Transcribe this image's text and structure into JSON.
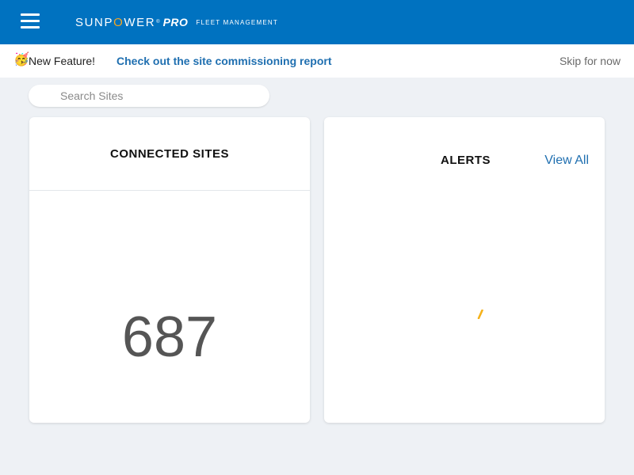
{
  "header": {
    "menu_icon": "hamburger-menu-icon",
    "brand": {
      "name_part1": "SUNP",
      "name_o": "O",
      "name_part2": "WER",
      "registered": "®",
      "pro": "PRO",
      "subtitle": "FLEET MANAGEMENT",
      "accent_color": "#f5a623"
    },
    "background_color": "#0072c0"
  },
  "banner": {
    "emoji": "🥳",
    "label": "New Feature!",
    "link_text": "Check out the site commissioning report",
    "skip_text": "Skip for now",
    "link_color": "#1f6fb0"
  },
  "search": {
    "placeholder": "Search Sites",
    "value": ""
  },
  "cards": {
    "connected_sites": {
      "title": "CONNECTED SITES",
      "value": "687"
    },
    "alerts": {
      "title": "ALERTS",
      "view_all": "View All",
      "loading_icon": "loading-spinner-icon",
      "spinner_color": "#f5b21b"
    }
  }
}
